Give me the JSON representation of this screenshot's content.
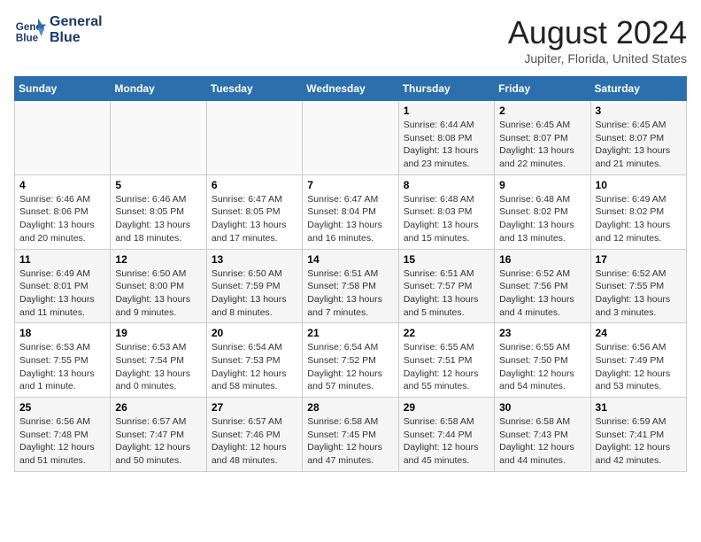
{
  "header": {
    "logo_line1": "General",
    "logo_line2": "Blue",
    "month_year": "August 2024",
    "location": "Jupiter, Florida, United States"
  },
  "weekdays": [
    "Sunday",
    "Monday",
    "Tuesday",
    "Wednesday",
    "Thursday",
    "Friday",
    "Saturday"
  ],
  "weeks": [
    [
      {
        "day": "",
        "info": ""
      },
      {
        "day": "",
        "info": ""
      },
      {
        "day": "",
        "info": ""
      },
      {
        "day": "",
        "info": ""
      },
      {
        "day": "1",
        "info": "Sunrise: 6:44 AM\nSunset: 8:08 PM\nDaylight: 13 hours\nand 23 minutes."
      },
      {
        "day": "2",
        "info": "Sunrise: 6:45 AM\nSunset: 8:07 PM\nDaylight: 13 hours\nand 22 minutes."
      },
      {
        "day": "3",
        "info": "Sunrise: 6:45 AM\nSunset: 8:07 PM\nDaylight: 13 hours\nand 21 minutes."
      }
    ],
    [
      {
        "day": "4",
        "info": "Sunrise: 6:46 AM\nSunset: 8:06 PM\nDaylight: 13 hours\nand 20 minutes."
      },
      {
        "day": "5",
        "info": "Sunrise: 6:46 AM\nSunset: 8:05 PM\nDaylight: 13 hours\nand 18 minutes."
      },
      {
        "day": "6",
        "info": "Sunrise: 6:47 AM\nSunset: 8:05 PM\nDaylight: 13 hours\nand 17 minutes."
      },
      {
        "day": "7",
        "info": "Sunrise: 6:47 AM\nSunset: 8:04 PM\nDaylight: 13 hours\nand 16 minutes."
      },
      {
        "day": "8",
        "info": "Sunrise: 6:48 AM\nSunset: 8:03 PM\nDaylight: 13 hours\nand 15 minutes."
      },
      {
        "day": "9",
        "info": "Sunrise: 6:48 AM\nSunset: 8:02 PM\nDaylight: 13 hours\nand 13 minutes."
      },
      {
        "day": "10",
        "info": "Sunrise: 6:49 AM\nSunset: 8:02 PM\nDaylight: 13 hours\nand 12 minutes."
      }
    ],
    [
      {
        "day": "11",
        "info": "Sunrise: 6:49 AM\nSunset: 8:01 PM\nDaylight: 13 hours\nand 11 minutes."
      },
      {
        "day": "12",
        "info": "Sunrise: 6:50 AM\nSunset: 8:00 PM\nDaylight: 13 hours\nand 9 minutes."
      },
      {
        "day": "13",
        "info": "Sunrise: 6:50 AM\nSunset: 7:59 PM\nDaylight: 13 hours\nand 8 minutes."
      },
      {
        "day": "14",
        "info": "Sunrise: 6:51 AM\nSunset: 7:58 PM\nDaylight: 13 hours\nand 7 minutes."
      },
      {
        "day": "15",
        "info": "Sunrise: 6:51 AM\nSunset: 7:57 PM\nDaylight: 13 hours\nand 5 minutes."
      },
      {
        "day": "16",
        "info": "Sunrise: 6:52 AM\nSunset: 7:56 PM\nDaylight: 13 hours\nand 4 minutes."
      },
      {
        "day": "17",
        "info": "Sunrise: 6:52 AM\nSunset: 7:55 PM\nDaylight: 13 hours\nand 3 minutes."
      }
    ],
    [
      {
        "day": "18",
        "info": "Sunrise: 6:53 AM\nSunset: 7:55 PM\nDaylight: 13 hours\nand 1 minute."
      },
      {
        "day": "19",
        "info": "Sunrise: 6:53 AM\nSunset: 7:54 PM\nDaylight: 13 hours\nand 0 minutes."
      },
      {
        "day": "20",
        "info": "Sunrise: 6:54 AM\nSunset: 7:53 PM\nDaylight: 12 hours\nand 58 minutes."
      },
      {
        "day": "21",
        "info": "Sunrise: 6:54 AM\nSunset: 7:52 PM\nDaylight: 12 hours\nand 57 minutes."
      },
      {
        "day": "22",
        "info": "Sunrise: 6:55 AM\nSunset: 7:51 PM\nDaylight: 12 hours\nand 55 minutes."
      },
      {
        "day": "23",
        "info": "Sunrise: 6:55 AM\nSunset: 7:50 PM\nDaylight: 12 hours\nand 54 minutes."
      },
      {
        "day": "24",
        "info": "Sunrise: 6:56 AM\nSunset: 7:49 PM\nDaylight: 12 hours\nand 53 minutes."
      }
    ],
    [
      {
        "day": "25",
        "info": "Sunrise: 6:56 AM\nSunset: 7:48 PM\nDaylight: 12 hours\nand 51 minutes."
      },
      {
        "day": "26",
        "info": "Sunrise: 6:57 AM\nSunset: 7:47 PM\nDaylight: 12 hours\nand 50 minutes."
      },
      {
        "day": "27",
        "info": "Sunrise: 6:57 AM\nSunset: 7:46 PM\nDaylight: 12 hours\nand 48 minutes."
      },
      {
        "day": "28",
        "info": "Sunrise: 6:58 AM\nSunset: 7:45 PM\nDaylight: 12 hours\nand 47 minutes."
      },
      {
        "day": "29",
        "info": "Sunrise: 6:58 AM\nSunset: 7:44 PM\nDaylight: 12 hours\nand 45 minutes."
      },
      {
        "day": "30",
        "info": "Sunrise: 6:58 AM\nSunset: 7:43 PM\nDaylight: 12 hours\nand 44 minutes."
      },
      {
        "day": "31",
        "info": "Sunrise: 6:59 AM\nSunset: 7:41 PM\nDaylight: 12 hours\nand 42 minutes."
      }
    ]
  ]
}
